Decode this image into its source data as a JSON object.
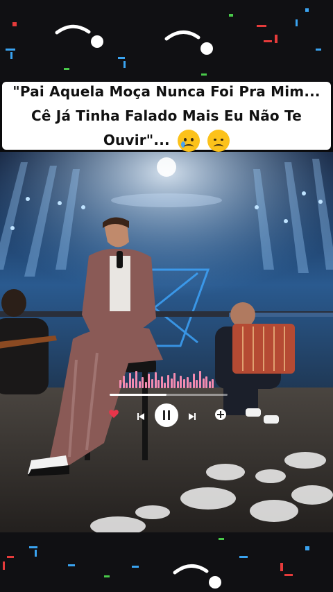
{
  "caption": {
    "text": "\"Pai Aquela Moça Nunca Foi Pra Mim... Cê Já Tinha Falado Mais Eu Não Te Ouvir\"...",
    "emojis": [
      "crying-face",
      "disappointed-face"
    ]
  },
  "player": {
    "progress": 0.48,
    "state": "paused-icon-shown",
    "accent": "#f48bb0",
    "heart_color": "#e8354a",
    "eq_levels": [
      0.45,
      0.7,
      0.3,
      0.85,
      0.55,
      0.95,
      0.4,
      0.6,
      0.35,
      0.8,
      0.5,
      0.9,
      0.45,
      0.65,
      0.3,
      0.75,
      0.55,
      0.85,
      0.4,
      0.7,
      0.5,
      0.6,
      0.35,
      0.8,
      0.45,
      0.95,
      0.55,
      0.65,
      0.4,
      0.5
    ]
  },
  "colors": {
    "background": "#101013",
    "stage_blue": "#2a6fb8",
    "suit": "#8a5a56"
  },
  "icons": [
    "music-note-icon",
    "heart-icon",
    "previous-icon",
    "pause-icon",
    "next-icon",
    "add-icon"
  ]
}
